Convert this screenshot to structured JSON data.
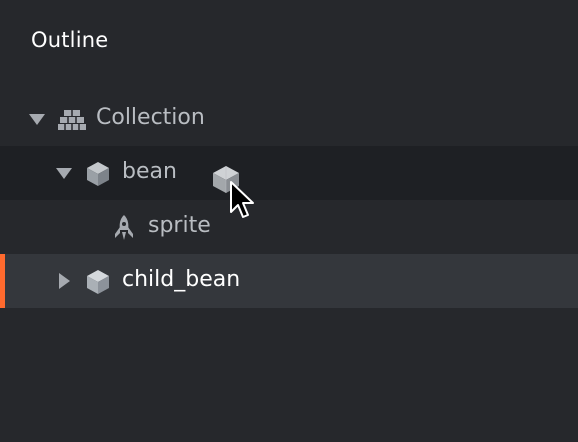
{
  "outline": {
    "title": "Outline",
    "items": [
      {
        "label": "Collection",
        "icon": "collection-icon",
        "expanded": true
      },
      {
        "label": "bean",
        "icon": "game-object-icon",
        "expanded": true
      },
      {
        "label": "sprite",
        "icon": "sprite-icon"
      },
      {
        "label": "child_bean",
        "icon": "game-object-icon",
        "expanded": false,
        "selected": true
      }
    ]
  },
  "colors": {
    "background": "#26282c",
    "hover_row": "#1e2024",
    "selected_row": "#34373c",
    "selection_accent": "#ff6a2e",
    "text": "#b9bdc2",
    "text_selected": "#ffffff"
  }
}
